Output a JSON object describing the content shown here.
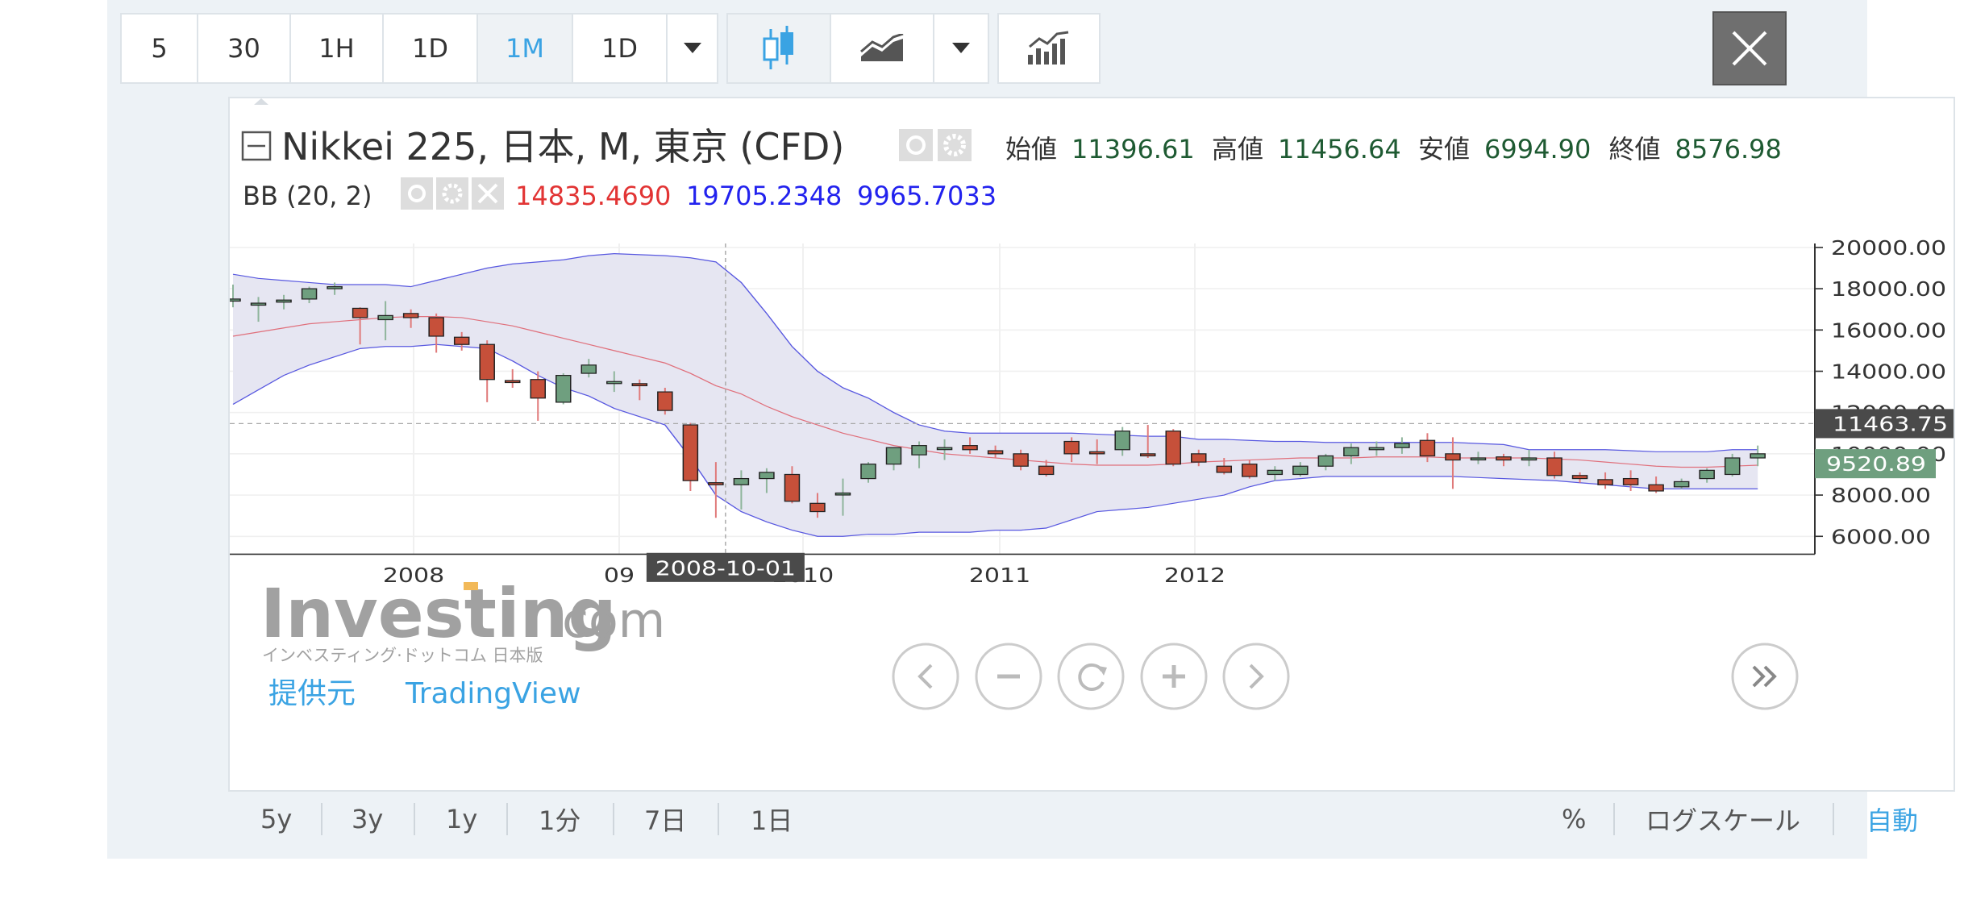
{
  "toolbar": {
    "intervals": [
      "5",
      "30",
      "1H",
      "1D",
      "1M",
      "1D"
    ],
    "active_interval_index": 4
  },
  "legend": {
    "symbol": "Nikkei 225, 日本, M, 東京 (CFD)",
    "ohlc": [
      {
        "label": "始値",
        "value": "11396.61"
      },
      {
        "label": "高値",
        "value": "11456.64"
      },
      {
        "label": "安値",
        "value": "6994.90"
      },
      {
        "label": "終値",
        "value": "8576.98"
      }
    ],
    "bb_label": "BB (20, 2)",
    "bb_values": [
      {
        "value": "14835.4690",
        "color": "#e23434"
      },
      {
        "value": "19705.2348",
        "color": "#2222ee"
      },
      {
        "value": "9965.7033",
        "color": "#2222ee"
      }
    ]
  },
  "watermark": {
    "brand": "Investing",
    "brand_suffix": ".com",
    "subtitle": "インベスティング·ドットコム 日本版",
    "provider_label": "提供元",
    "provider": "TradingView"
  },
  "price_axis": {
    "ticks": [
      "20000.00",
      "18000.00",
      "16000.00",
      "14000.00",
      "12000.00",
      "10000.00",
      "8000.00",
      "6000.00"
    ],
    "crosshair_label": "11463.75",
    "last_price_label": "9520.89"
  },
  "time_axis": {
    "ticks": [
      "2008",
      "09",
      "2010",
      "2011",
      "2012"
    ],
    "crosshair_label": "2008-10-01"
  },
  "bottom": {
    "ranges": [
      "5y",
      "3y",
      "1y",
      "1分",
      "7日",
      "1日"
    ],
    "percent": "%",
    "log_scale": "ログスケール",
    "auto": "自動"
  },
  "colors": {
    "up": "#6f9f7f",
    "down": "#c6503a",
    "band_fill": "#e6e6f2",
    "band_line": "#5858e0",
    "basis_line": "#e0707c",
    "accent": "#3aa3e3",
    "last_price_bg": "#6f9f7f"
  },
  "chart_data": {
    "type": "candlestick",
    "interval": "monthly",
    "x": [
      "2007-03",
      "2007-04",
      "2007-05",
      "2007-06",
      "2007-07",
      "2007-08",
      "2007-09",
      "2007-10",
      "2007-11",
      "2007-12",
      "2008-01",
      "2008-02",
      "2008-03",
      "2008-04",
      "2008-05",
      "2008-06",
      "2008-07",
      "2008-08",
      "2008-09",
      "2008-10",
      "2008-11",
      "2008-12",
      "2009-01",
      "2009-02",
      "2009-03",
      "2009-04",
      "2009-05",
      "2009-06",
      "2009-07",
      "2009-08",
      "2009-09",
      "2009-10",
      "2009-11",
      "2009-12",
      "2010-01",
      "2010-02",
      "2010-03",
      "2010-04",
      "2010-05",
      "2010-06",
      "2010-07",
      "2010-08",
      "2010-09",
      "2010-10",
      "2010-11",
      "2010-12",
      "2011-01",
      "2011-02",
      "2011-03",
      "2011-04",
      "2011-05",
      "2011-06",
      "2011-07",
      "2011-08",
      "2011-09",
      "2011-10",
      "2011-11",
      "2011-12",
      "2012-01",
      "2012-02",
      "2012-03"
    ],
    "open": [
      17400,
      17250,
      17350,
      17500,
      18000,
      17050,
      16500,
      16800,
      16600,
      15650,
      15300,
      13550,
      13600,
      12500,
      13900,
      13500,
      13400,
      13000,
      11400,
      8600,
      8500,
      8800,
      9000,
      7600,
      8100,
      8800,
      9500,
      9950,
      10300,
      10400,
      10150,
      10000,
      9400,
      10600,
      10100,
      10200,
      10000,
      11100,
      10000,
      9400,
      9500,
      9000,
      9000,
      9400,
      9900,
      10200,
      10300,
      10650,
      10000,
      9800,
      9850,
      9700,
      9800,
      8950,
      8750,
      8800,
      8500,
      8400,
      8800,
      9000,
      9800
    ],
    "close": [
      17500,
      17300,
      17450,
      18000,
      18100,
      16600,
      16700,
      16600,
      15700,
      15300,
      13600,
      13500,
      12700,
      13800,
      14300,
      13500,
      13300,
      12100,
      8700,
      8500,
      8800,
      9100,
      7700,
      7200,
      8100,
      9500,
      10300,
      10400,
      10300,
      10200,
      10000,
      9400,
      9000,
      10000,
      10000,
      11100,
      9900,
      9500,
      9600,
      9100,
      8900,
      9200,
      9400,
      9900,
      10300,
      10300,
      10500,
      9900,
      9700,
      9800,
      9700,
      9800,
      8950,
      8800,
      8500,
      8500,
      8200,
      8650,
      9200,
      9800,
      10000
    ],
    "high": [
      18200,
      17600,
      17700,
      18100,
      18300,
      17100,
      17400,
      17000,
      16800,
      15900,
      15500,
      14100,
      14000,
      13900,
      14600,
      14000,
      13600,
      13200,
      11500,
      9600,
      9200,
      9300,
      9400,
      8100,
      8800,
      9600,
      10300,
      10600,
      10700,
      10800,
      10400,
      10200,
      9700,
      10800,
      10700,
      11300,
      11400,
      11200,
      10200,
      9800,
      9700,
      9400,
      9600,
      10000,
      10500,
      10600,
      10800,
      11000,
      10800,
      10100,
      10000,
      10200,
      10100,
      9100,
      9100,
      9200,
      8900,
      8800,
      9300,
      10000,
      10400
    ],
    "low": [
      17100,
      16400,
      17000,
      17300,
      17700,
      15300,
      15500,
      16100,
      14900,
      15000,
      12500,
      13200,
      11600,
      12400,
      13700,
      13000,
      12600,
      11900,
      8200,
      6900,
      7300,
      8100,
      7600,
      6900,
      7000,
      8600,
      9200,
      9300,
      9700,
      10000,
      9800,
      9200,
      8900,
      9600,
      9500,
      9900,
      9800,
      9400,
      9400,
      9000,
      8800,
      8700,
      8900,
      9200,
      9500,
      9900,
      10000,
      9600,
      8300,
      9500,
      9400,
      9400,
      8800,
      8600,
      8300,
      8200,
      8100,
      8300,
      8600,
      8900,
      9400
    ],
    "bb_upper": [
      18700,
      18500,
      18400,
      18300,
      18200,
      18200,
      18200,
      18100,
      18400,
      18700,
      19000,
      19200,
      19300,
      19400,
      19600,
      19700,
      19650,
      19600,
      19500,
      19300,
      18300,
      16800,
      15200,
      14000,
      13200,
      12700,
      12000,
      11400,
      11100,
      11000,
      11000,
      11000,
      11000,
      11000,
      10950,
      10900,
      10850,
      10850,
      10700,
      10700,
      10650,
      10600,
      10600,
      10550,
      10550,
      10550,
      10550,
      10550,
      10550,
      10500,
      10450,
      10200,
      10200,
      10200,
      10200,
      10150,
      10100,
      10100,
      10100,
      10200,
      10200
    ],
    "bb_basis": [
      15700,
      15900,
      16100,
      16300,
      16400,
      16500,
      16600,
      16650,
      16650,
      16600,
      16400,
      16200,
      15900,
      15600,
      15300,
      15000,
      14700,
      14400,
      13900,
      13300,
      12900,
      12300,
      11800,
      11400,
      11000,
      10700,
      10400,
      10200,
      10000,
      9900,
      9800,
      9700,
      9600,
      9500,
      9450,
      9450,
      9450,
      9500,
      9600,
      9650,
      9700,
      9750,
      9800,
      9800,
      9800,
      9850,
      9850,
      9850,
      9800,
      9800,
      9800,
      9800,
      9750,
      9700,
      9600,
      9500,
      9400,
      9350,
      9350,
      9400,
      9450
    ],
    "bb_lower": [
      12400,
      13100,
      13800,
      14300,
      14700,
      15100,
      15200,
      15200,
      15300,
      15200,
      15100,
      14500,
      13800,
      13200,
      12800,
      12200,
      11800,
      11400,
      9800,
      8000,
      7200,
      6700,
      6300,
      6000,
      6000,
      6100,
      6100,
      6200,
      6200,
      6200,
      6300,
      6300,
      6400,
      6800,
      7200,
      7300,
      7400,
      7600,
      7800,
      8000,
      8400,
      8700,
      8800,
      8900,
      8900,
      8900,
      8900,
      8900,
      8900,
      8850,
      8800,
      8750,
      8700,
      8600,
      8500,
      8400,
      8300,
      8300,
      8300,
      8300,
      8300
    ],
    "ylim": [
      5000,
      21500
    ],
    "yticks": [
      20000,
      18000,
      16000,
      14000,
      12000,
      10000,
      8000,
      6000
    ],
    "crosshair": {
      "x": "2008-10",
      "y": 11463.75
    },
    "last_price": 9520.89
  }
}
